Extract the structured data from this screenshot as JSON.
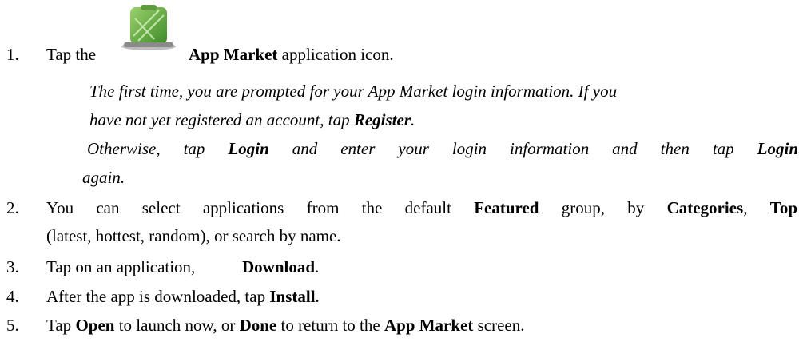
{
  "items": [
    {
      "num": "1.",
      "pre": "Tap the",
      "bold": "App Market",
      "post": " application icon."
    },
    {
      "num": "2.",
      "line1_a": "You can select applications from the default ",
      "line1_b": "Featured",
      "line1_c": " group, by ",
      "line1_d": "Categories",
      "line1_e": ", ",
      "line1_f": "Top",
      "line2": "(latest, hottest, random), or search by name."
    },
    {
      "num": "3.",
      "pre": "Tap on an application,",
      "bold": "Download",
      "post": "."
    },
    {
      "num": "4.",
      "pre": "After the app is downloaded, tap ",
      "bold": "Install",
      "post": "."
    },
    {
      "num": "5.",
      "a": "Tap ",
      "b": "Open",
      "c": " to launch now, or ",
      "d": "Done",
      "e": " to return to the ",
      "f": "App Market",
      "g": " screen."
    }
  ],
  "notes": {
    "n1_line1": "The first time, you are prompted for your App Market login information. If you",
    "n1_line2_a": "have not yet registered an account, tap ",
    "n1_line2_b": "Register",
    "n1_line2_c": ".",
    "n2_a": "Otherwise, tap ",
    "n2_b": "Login",
    "n2_c": " and enter your login information and then tap ",
    "n2_d": "Login",
    "n2_e": "again."
  },
  "icon": {
    "name": "app-market-icon",
    "color_main": "#6aa84f",
    "color_dark": "#3d7a2a"
  }
}
